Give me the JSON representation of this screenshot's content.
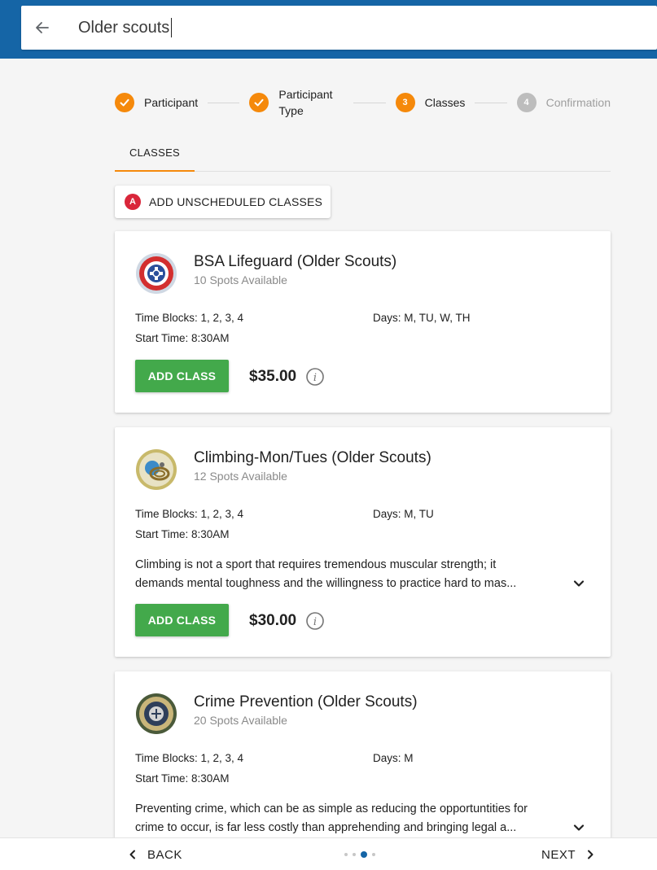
{
  "search": {
    "value": "Older scouts"
  },
  "stepper": {
    "steps": [
      {
        "label": "Participant",
        "state": "done",
        "number": ""
      },
      {
        "label": "Participant Type",
        "state": "done",
        "number": ""
      },
      {
        "label": "Classes",
        "state": "active",
        "number": "3"
      },
      {
        "label": "Confirmation",
        "state": "pending",
        "number": "4"
      }
    ]
  },
  "tabs": {
    "classes": "CLASSES"
  },
  "unscheduled": {
    "badge": "A",
    "label": "ADD UNSCHEDULED CLASSES"
  },
  "classes": [
    {
      "title": "BSA Lifeguard (Older Scouts)",
      "spots": "10 Spots Available",
      "time_blocks": "Time Blocks: 1, 2, 3, 4",
      "days": "Days: M, TU, W, TH",
      "start_time": "Start Time: 8:30AM",
      "description_1": "",
      "description_2": "",
      "add_label": "ADD CLASS",
      "price": "$35.00"
    },
    {
      "title": "Climbing-Mon/Tues (Older Scouts)",
      "spots": "12 Spots Available",
      "time_blocks": "Time Blocks: 1, 2, 3, 4",
      "days": "Days: M, TU",
      "start_time": "Start Time: 8:30AM",
      "description_1": "Climbing is not a sport that requires tremendous muscular strength; it",
      "description_2": "demands mental toughness and the willingness to practice hard to mas...",
      "add_label": "ADD CLASS",
      "price": "$30.00"
    },
    {
      "title": "Crime Prevention (Older Scouts)",
      "spots": "20 Spots Available",
      "time_blocks": "Time Blocks: 1, 2, 3, 4",
      "days": "Days: M",
      "start_time": "Start Time: 8:30AM",
      "description_1": "Preventing crime, which can be as simple as reducing the opportuntities for",
      "description_2": "crime to occur, is far less costly than apprehending and bringing legal a...",
      "add_label": "",
      "price": ""
    }
  ],
  "nav": {
    "back": "BACK",
    "next": "NEXT"
  },
  "colors": {
    "primary": "#1565a6",
    "accent_orange": "#f5890b",
    "success_green": "#43a94b",
    "badge_red": "#d9263a"
  }
}
